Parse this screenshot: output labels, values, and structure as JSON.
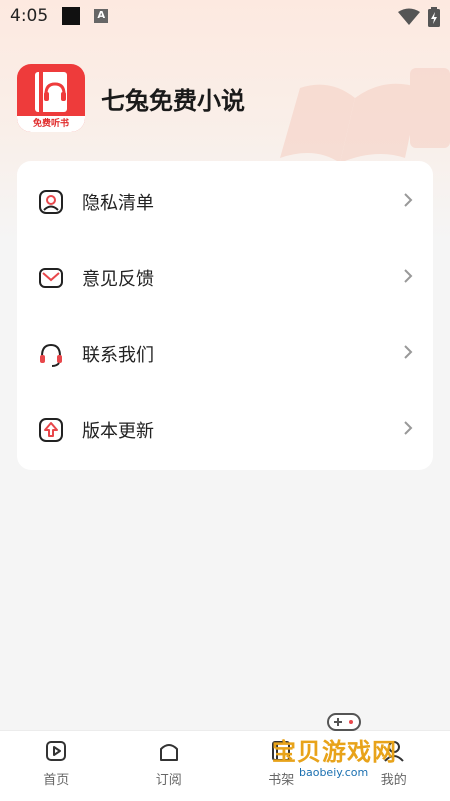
{
  "status_bar": {
    "time": "4:05",
    "notif_glyph": "A"
  },
  "header": {
    "title": "七兔免费小说",
    "logo_badge": "免费听书"
  },
  "menu": {
    "items": [
      {
        "label": "隐私清单",
        "icon": "privacy-icon"
      },
      {
        "label": "意见反馈",
        "icon": "mail-icon"
      },
      {
        "label": "联系我们",
        "icon": "headset-icon"
      },
      {
        "label": "版本更新",
        "icon": "update-icon"
      }
    ]
  },
  "nav": {
    "items": [
      {
        "label": "首页",
        "icon": "play-icon"
      },
      {
        "label": "订阅",
        "icon": "home-icon"
      },
      {
        "label": "书架",
        "icon": "bookshelf-icon"
      },
      {
        "label": "我的",
        "icon": "profile-icon"
      }
    ]
  },
  "watermark": {
    "text": "宝贝游戏网",
    "url": "baobeiy.com"
  },
  "colors": {
    "accent": "#e8474b",
    "background": "#f5f5f5"
  }
}
